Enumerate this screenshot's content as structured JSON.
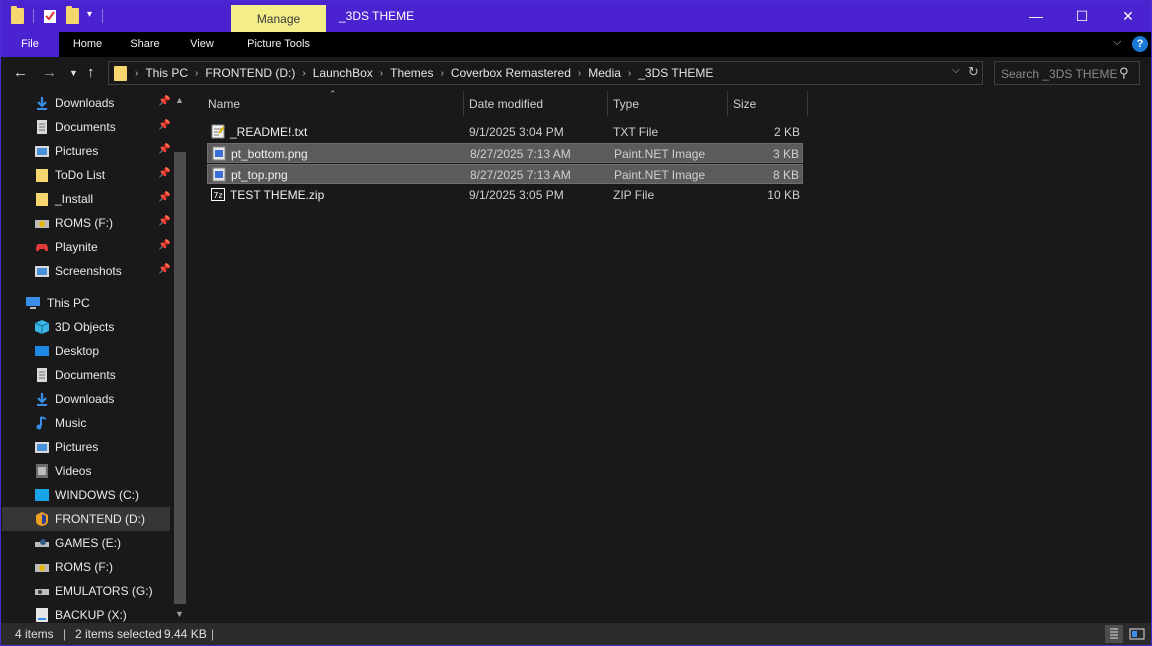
{
  "window": {
    "title": "_3DS THEME",
    "context_tab": "Manage",
    "controls": {
      "minimize": "—",
      "maximize": "☐",
      "close": "✕"
    }
  },
  "ribbon": {
    "tabs": [
      "File",
      "Home",
      "Share",
      "View",
      "Picture Tools"
    ]
  },
  "address": {
    "crumbs": [
      "This PC",
      "FRONTEND (D:)",
      "LaunchBox",
      "Themes",
      "Coverbox Remastered",
      "Media",
      "_3DS THEME"
    ],
    "search_placeholder": "Search _3DS THEME"
  },
  "sidebar": {
    "quick_access": [
      {
        "label": "Downloads",
        "icon": "download-arrow-icon",
        "pinned": true
      },
      {
        "label": "Documents",
        "icon": "documents-icon",
        "pinned": true
      },
      {
        "label": "Pictures",
        "icon": "pictures-icon",
        "pinned": true
      },
      {
        "label": "ToDo List",
        "icon": "folder-icon",
        "pinned": true
      },
      {
        "label": "_Install",
        "icon": "folder-icon",
        "pinned": true
      },
      {
        "label": "ROMS (F:)",
        "icon": "drive-icon",
        "pinned": true
      },
      {
        "label": "Playnite",
        "icon": "gamepad-icon",
        "pinned": true
      },
      {
        "label": "Screenshots",
        "icon": "pictures-icon",
        "pinned": true
      }
    ],
    "this_pc_label": "This PC",
    "this_pc_items": [
      {
        "label": "3D Objects",
        "icon": "3d-objects-icon"
      },
      {
        "label": "Desktop",
        "icon": "desktop-icon"
      },
      {
        "label": "Documents",
        "icon": "documents-icon"
      },
      {
        "label": "Downloads",
        "icon": "download-arrow-icon"
      },
      {
        "label": "Music",
        "icon": "music-note-icon"
      },
      {
        "label": "Pictures",
        "icon": "pictures-icon"
      },
      {
        "label": "Videos",
        "icon": "videos-icon"
      },
      {
        "label": "WINDOWS (C:)",
        "icon": "windows-drive-icon"
      },
      {
        "label": "FRONTEND (D:)",
        "icon": "drive-icon",
        "selected": true
      },
      {
        "label": "GAMES (E:)",
        "icon": "steam-drive-icon"
      },
      {
        "label": "ROMS (F:)",
        "icon": "drive-icon"
      },
      {
        "label": "EMULATORS (G:)",
        "icon": "drive-icon"
      },
      {
        "label": "BACKUP (X:)",
        "icon": "drive-icon"
      }
    ]
  },
  "filelist": {
    "columns": {
      "name": "Name",
      "date": "Date modified",
      "type": "Type",
      "size": "Size"
    },
    "files": [
      {
        "name": "_README!.txt",
        "date": "9/1/2025 3:04 PM",
        "type": "TXT File",
        "size": "2 KB",
        "icon": "text-file-icon",
        "selected": false
      },
      {
        "name": "pt_bottom.png",
        "date": "8/27/2025 7:13 AM",
        "type": "Paint.NET Image",
        "size": "3 KB",
        "icon": "image-file-icon",
        "selected": true
      },
      {
        "name": "pt_top.png",
        "date": "8/27/2025 7:13 AM",
        "type": "Paint.NET Image",
        "size": "8 KB",
        "icon": "image-file-icon",
        "selected": true
      },
      {
        "name": "TEST THEME.zip",
        "date": "9/1/2025 3:05 PM",
        "type": "ZIP File",
        "size": "10 KB",
        "icon": "zip-file-icon",
        "selected": false
      }
    ]
  },
  "status": {
    "item_count": "4 items",
    "selected": "2 items selected",
    "selected_size": "9.44 KB"
  },
  "colors": {
    "accent": "#4b22cf",
    "manage_tab": "#f4ee8a",
    "folder": "#f5d76e",
    "selection": "#5b5b5b"
  }
}
